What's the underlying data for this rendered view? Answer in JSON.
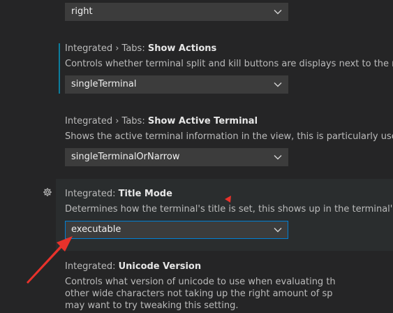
{
  "settings": [
    {
      "select_value": "right"
    },
    {
      "prefix": "Integrated › Tabs: ",
      "name": "Show Actions",
      "description": "Controls whether terminal split and kill buttons are displays next to the new terminal button.",
      "select_value": "singleTerminal"
    },
    {
      "prefix": "Integrated › Tabs: ",
      "name": "Show Active Terminal",
      "description": "Shows the active terminal information in the view, this is particularly useful when the title in the tabs are not visible.",
      "select_value": "singleTerminalOrNarrow"
    },
    {
      "prefix": "Integrated: ",
      "name": "Title Mode",
      "description": "Determines how the terminal's title is set, this shows up in the terminal's tab or dropdown entry.",
      "select_value": "executable"
    },
    {
      "prefix": "Integrated: ",
      "name": "Unicode Version",
      "description_lines": [
        "Controls what version of unicode to use when evaluating th",
        "other wide characters not taking up the right amount of sp",
        "may want to try tweaking this setting."
      ]
    }
  ],
  "colors": {
    "background": "#252526",
    "focused_row": "#2a2d2e",
    "select_border_active": "#007fd4",
    "annotation_arrow": "#e8322b"
  },
  "icons": {
    "gear": "gear-icon",
    "chevron": "chevron-down-icon"
  }
}
